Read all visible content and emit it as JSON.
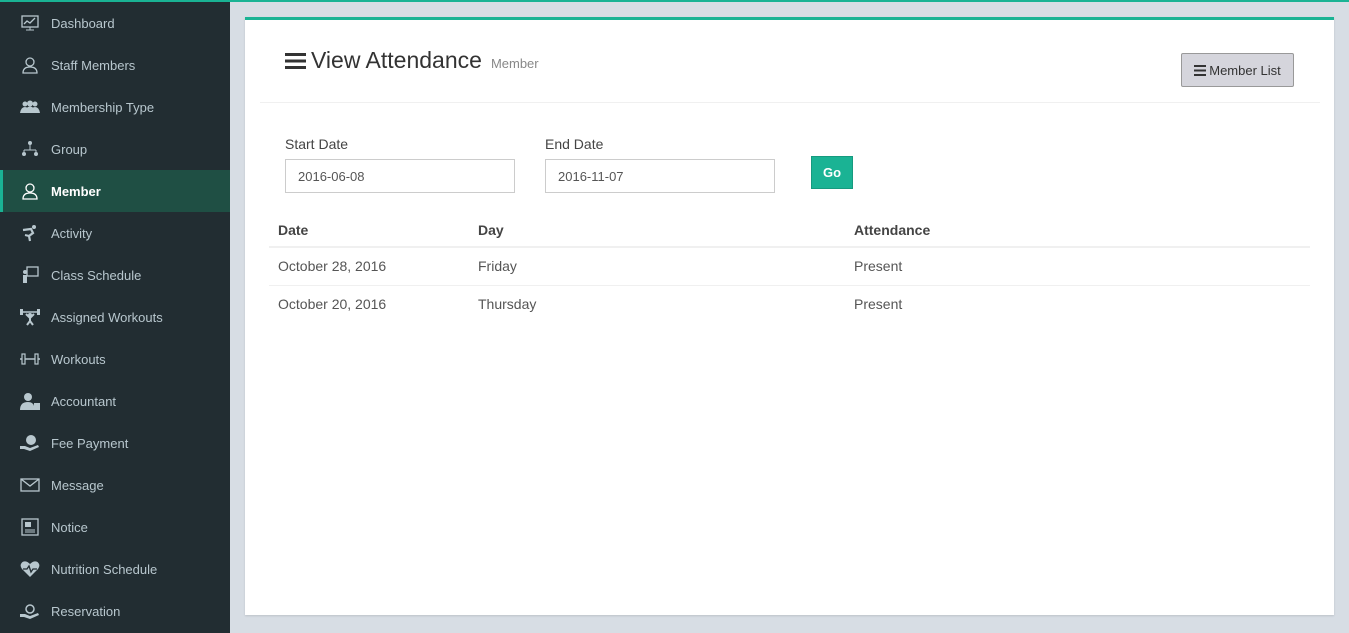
{
  "sidebar": {
    "items": [
      {
        "label": "Dashboard",
        "icon": "dashboard-icon"
      },
      {
        "label": "Staff Members",
        "icon": "staff-icon"
      },
      {
        "label": "Membership Type",
        "icon": "membership-icon"
      },
      {
        "label": "Group",
        "icon": "group-icon"
      },
      {
        "label": "Member",
        "icon": "member-icon",
        "active": true
      },
      {
        "label": "Activity",
        "icon": "activity-icon"
      },
      {
        "label": "Class Schedule",
        "icon": "class-schedule-icon"
      },
      {
        "label": "Assigned Workouts",
        "icon": "assigned-workouts-icon"
      },
      {
        "label": "Workouts",
        "icon": "dumbbell-icon"
      },
      {
        "label": "Accountant",
        "icon": "accountant-icon"
      },
      {
        "label": "Fee Payment",
        "icon": "fee-payment-icon"
      },
      {
        "label": "Message",
        "icon": "envelope-icon"
      },
      {
        "label": "Notice",
        "icon": "notice-icon"
      },
      {
        "label": "Nutrition Schedule",
        "icon": "heart-icon"
      },
      {
        "label": "Reservation",
        "icon": "reservation-icon"
      }
    ]
  },
  "header": {
    "title": "View Attendance",
    "subtitle": "Member",
    "member_list_label": "Member List"
  },
  "filters": {
    "start_label": "Start Date",
    "start_value": "2016-06-08",
    "end_label": "End Date",
    "end_value": "2016-11-07",
    "go_label": "Go"
  },
  "table": {
    "headers": [
      "Date",
      "Day",
      "Attendance"
    ],
    "rows": [
      [
        "October 28, 2016",
        "Friday",
        "Present"
      ],
      [
        "October 20, 2016",
        "Thursday",
        "Present"
      ]
    ]
  },
  "colors": {
    "accent": "#1ab394",
    "sidebar_bg": "#222d32",
    "active_bg": "#1f4f44"
  }
}
